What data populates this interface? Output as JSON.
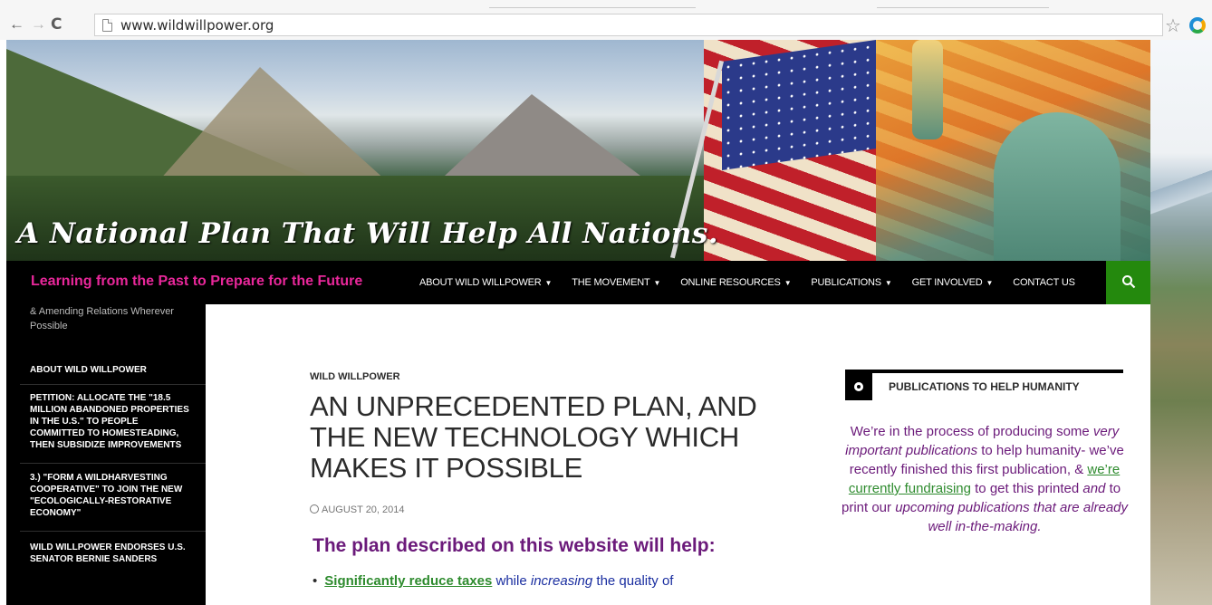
{
  "browser": {
    "url": "www.wildwillpower.org",
    "back_icon": "←",
    "forward_icon": "→",
    "reload_icon": "C",
    "star_icon": "☆"
  },
  "header": {
    "tagline": "A National Plan That Will Help All Nations."
  },
  "navbar": {
    "site_title": "Learning from the Past to Prepare for the Future",
    "menu": [
      {
        "label": "ABOUT WILD WILLPOWER",
        "dropdown": true
      },
      {
        "label": "THE MOVEMENT",
        "dropdown": true
      },
      {
        "label": "ONLINE RESOURCES",
        "dropdown": true
      },
      {
        "label": "PUBLICATIONS",
        "dropdown": true
      },
      {
        "label": "GET INVOLVED",
        "dropdown": true
      },
      {
        "label": "CONTACT US",
        "dropdown": false
      }
    ],
    "caret": "▼",
    "search_icon": "🔍"
  },
  "sidebar": {
    "description": "& Amending Relations Wherever Possible",
    "items": [
      {
        "label": "ABOUT WILD WILLPOWER"
      },
      {
        "label": "PETITION: ALLOCATE THE \"18.5 MILLION ABANDONED PROPERTIES IN THE U.S.\" TO PEOPLE COMMITTED TO HOMESTEADING, THEN SUBSIDIZE IMPROVEMENTS"
      },
      {
        "label": "3.) \"FORM A WILDHARVESTING COOPERATIVE\" TO JOIN THE NEW \"ECOLOGICALLY-RESTORATIVE ECONOMY\""
      },
      {
        "label": "WILD WILLPOWER ENDORSES U.S. SENATOR BERNIE SANDERS"
      }
    ]
  },
  "post": {
    "category": "WILD WILLPOWER",
    "title": "AN UNPRECEDENTED PLAN, AND THE NEW TECHNOLOGY WHICH MAKES IT POSSIBLE",
    "date": "AUGUST 20, 2014",
    "date_icon": "🕓",
    "plan_heading": "The plan described on this website will help:",
    "bullet_link": "Significantly reduce taxes",
    "bullet_rest_1": " while ",
    "bullet_italic": "increasing",
    "bullet_rest_2": " the quality of"
  },
  "widget": {
    "title": "PUBLICATIONS TO HELP HUMANITY",
    "text_1": "We’re in the process of producing some ",
    "text_italic_1": "very important publications",
    "text_2": " to help humanity- we’ve recently finished this first publication, & ",
    "text_link": "we’re currently fundraising",
    "text_3": " to get this printed ",
    "text_italic_2": "and",
    "text_4": " to print our ",
    "text_italic_3": "upcoming publications that are already well in-the-making.",
    "colors": {
      "text": "#6b1a7a",
      "link": "#2e8b2e"
    }
  },
  "colors": {
    "site_title": "#e8279a",
    "search_button": "#24890d",
    "navbar": "#000000"
  }
}
